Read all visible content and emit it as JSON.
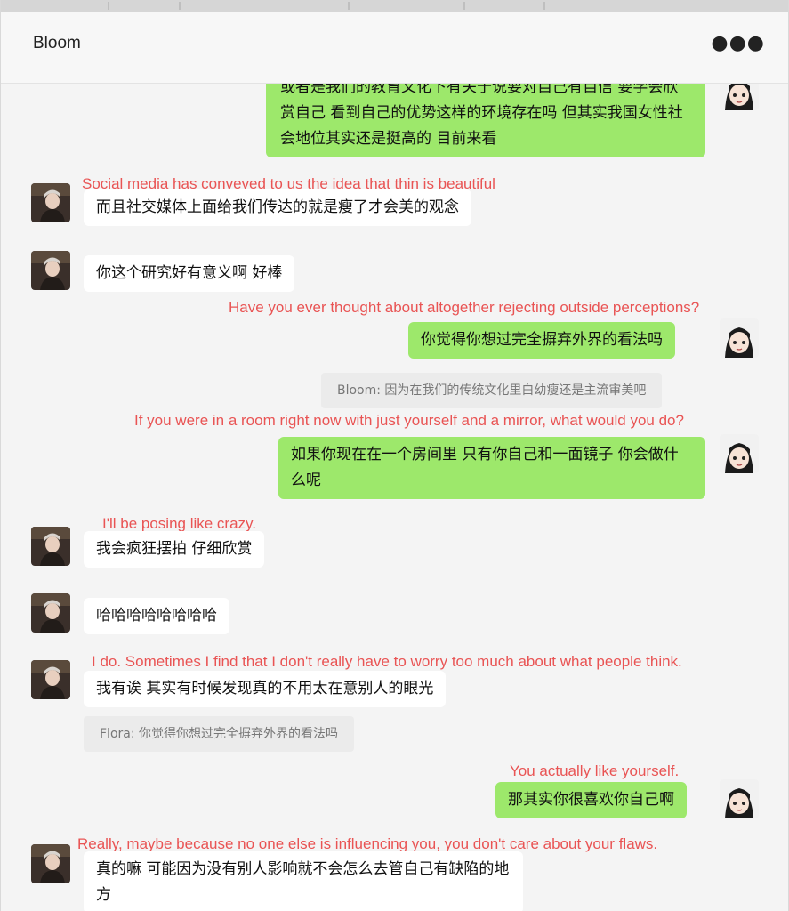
{
  "window": {
    "title": "Bloom",
    "more_icon": "more-horizontal-icon"
  },
  "messages": {
    "m1": {
      "side": "right",
      "text": "或者是我们的教育文化下有关于说要对自己有自信 要学会欣赏自己 看到自己的优势这样的环境存在吗 但其实我国女性社会地位其实还是挺高的 目前来看"
    },
    "m2": {
      "side": "left",
      "translation": "Social media has conveyed to us the idea that thin is beautiful",
      "text": "而且社交媒体上面给我们传达的就是瘦了才会美的观念"
    },
    "m3": {
      "side": "left",
      "text": "你这个研究好有意义啊 好棒"
    },
    "m4": {
      "side": "right",
      "translation": "Have you ever thought about altogether rejecting outside perceptions?",
      "text": "你觉得你想过完全摒弃外界的看法吗"
    },
    "q1": {
      "text": "Bloom: 因为在我们的传统文化里白幼瘦还是主流审美吧"
    },
    "m5": {
      "side": "right",
      "translation": "If you were in a room right now with just yourself and a mirror, what would you do?",
      "text": "如果你现在在一个房间里 只有你自己和一面镜子 你会做什么呢"
    },
    "m6": {
      "side": "left",
      "translation": "I'll be posing like crazy.",
      "text": "我会疯狂摆拍 仔细欣赏"
    },
    "m7": {
      "side": "left",
      "text": "哈哈哈哈哈哈哈哈"
    },
    "m8": {
      "side": "left",
      "translation": "I do. Sometimes I find that I don't really have to worry too much about what people think.",
      "text": "我有诶 其实有时候发现真的不用太在意别人的眼光"
    },
    "q2": {
      "text": "Flora: 你觉得你想过完全摒弃外界的看法吗"
    },
    "m9": {
      "side": "right",
      "translation": "You actually like yourself.",
      "text": "那其实你很喜欢你自己啊"
    },
    "m10": {
      "side": "left",
      "translation": "Really, maybe because no one else is influencing you, you don't care about your flaws.",
      "text": "真的嘛 可能因为没有别人影响就不会怎么去管自己有缺陷的地方"
    }
  },
  "colors": {
    "green_bubble": "#9de86b",
    "white_bubble": "#ffffff",
    "translation_red": "#e95454",
    "chat_background": "#f4f4f4"
  }
}
